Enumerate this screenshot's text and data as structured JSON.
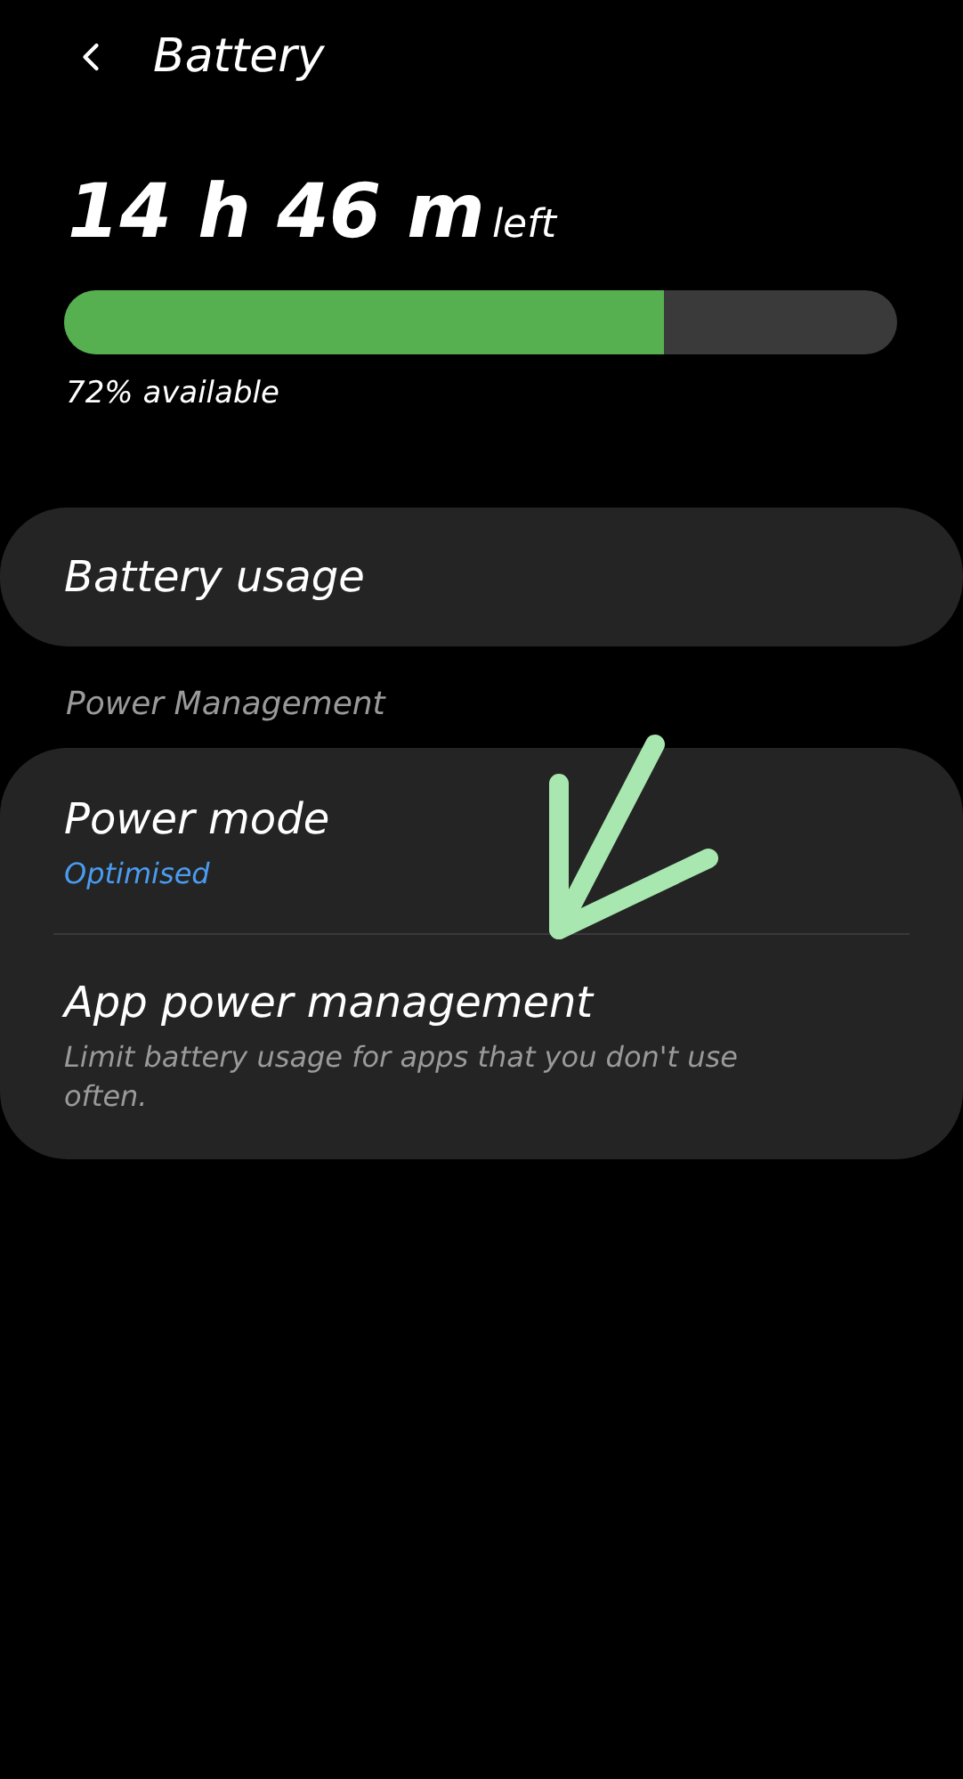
{
  "header": {
    "title": "Battery"
  },
  "time_left": {
    "value": "14 h 46 m",
    "suffix": "left"
  },
  "battery": {
    "level": 0.72,
    "reading": "72% available"
  },
  "usage_card": {
    "label": "Battery usage"
  },
  "section_title": "Power Management",
  "power_items": [
    {
      "title": "Power mode",
      "subtitle": "Optimised",
      "kind": "status"
    },
    {
      "title": "App power management",
      "subtitle": "Limit battery usage for apps that you don't use often.",
      "kind": "description"
    }
  ],
  "annotation": {
    "kind": "arrow"
  }
}
